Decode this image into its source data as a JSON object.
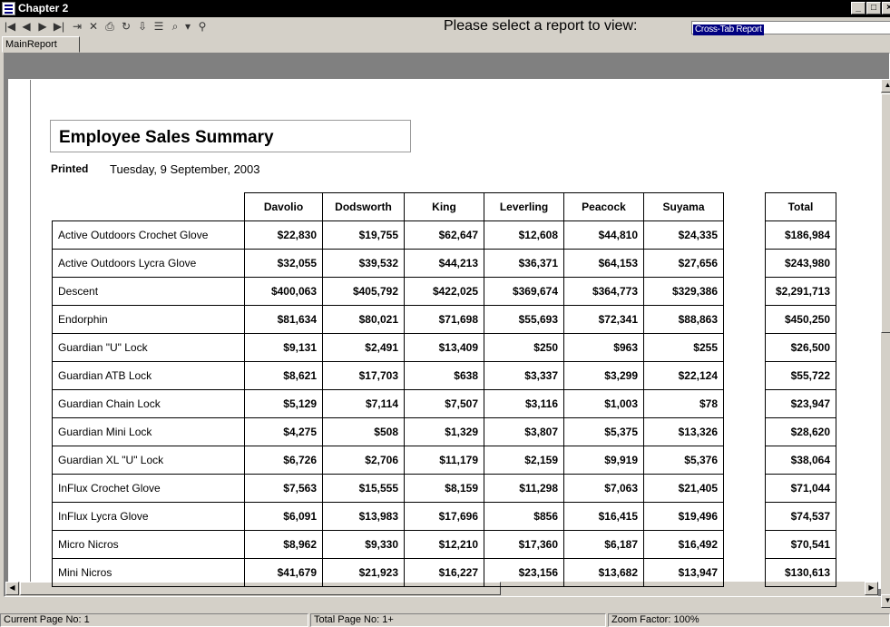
{
  "window": {
    "title": "Chapter 2"
  },
  "toolbar": {
    "icons": [
      "first-page-icon",
      "previous-page-icon",
      "next-page-icon",
      "last-page-icon",
      "goto-page-icon",
      "close-view-icon",
      "print-icon",
      "refresh-icon",
      "export-icon",
      "group-tree-icon",
      "zoom-icon",
      "dropdown-arrow-icon",
      "search-text-icon"
    ],
    "report_prompt": "Please select a report to view:",
    "report_select_value": "Cross-Tab Report"
  },
  "tabs": [
    {
      "label": "MainReport"
    }
  ],
  "report": {
    "title": "Employee Sales Summary",
    "printed_label": "Printed",
    "printed_date": "Tuesday, 9 September, 2003",
    "columns": [
      "Davolio",
      "Dodsworth",
      "King",
      "Leverling",
      "Peacock",
      "Suyama"
    ],
    "total_header": "Total",
    "rows": [
      {
        "product": "Active Outdoors Crochet Glove",
        "values": [
          "$22,830",
          "$19,755",
          "$62,647",
          "$12,608",
          "$44,810",
          "$24,335"
        ],
        "total": "$186,984"
      },
      {
        "product": "Active Outdoors Lycra Glove",
        "values": [
          "$32,055",
          "$39,532",
          "$44,213",
          "$36,371",
          "$64,153",
          "$27,656"
        ],
        "total": "$243,980"
      },
      {
        "product": "Descent",
        "values": [
          "$400,063",
          "$405,792",
          "$422,025",
          "$369,674",
          "$364,773",
          "$329,386"
        ],
        "total": "$2,291,713"
      },
      {
        "product": "Endorphin",
        "values": [
          "$81,634",
          "$80,021",
          "$71,698",
          "$55,693",
          "$72,341",
          "$88,863"
        ],
        "total": "$450,250"
      },
      {
        "product": "Guardian \"U\" Lock",
        "values": [
          "$9,131",
          "$2,491",
          "$13,409",
          "$250",
          "$963",
          "$255"
        ],
        "total": "$26,500"
      },
      {
        "product": "Guardian ATB Lock",
        "values": [
          "$8,621",
          "$17,703",
          "$638",
          "$3,337",
          "$3,299",
          "$22,124"
        ],
        "total": "$55,722"
      },
      {
        "product": "Guardian Chain Lock",
        "values": [
          "$5,129",
          "$7,114",
          "$7,507",
          "$3,116",
          "$1,003",
          "$78"
        ],
        "total": "$23,947"
      },
      {
        "product": "Guardian Mini Lock",
        "values": [
          "$4,275",
          "$508",
          "$1,329",
          "$3,807",
          "$5,375",
          "$13,326"
        ],
        "total": "$28,620"
      },
      {
        "product": "Guardian XL \"U\" Lock",
        "values": [
          "$6,726",
          "$2,706",
          "$11,179",
          "$2,159",
          "$9,919",
          "$5,376"
        ],
        "total": "$38,064"
      },
      {
        "product": "InFlux Crochet Glove",
        "values": [
          "$7,563",
          "$15,555",
          "$8,159",
          "$11,298",
          "$7,063",
          "$21,405"
        ],
        "total": "$71,044"
      },
      {
        "product": "InFlux Lycra Glove",
        "values": [
          "$6,091",
          "$13,983",
          "$17,696",
          "$856",
          "$16,415",
          "$19,496"
        ],
        "total": "$74,537"
      },
      {
        "product": "Micro Nicros",
        "values": [
          "$8,962",
          "$9,330",
          "$12,210",
          "$17,360",
          "$6,187",
          "$16,492"
        ],
        "total": "$70,541"
      },
      {
        "product": "Mini Nicros",
        "values": [
          "$41,679",
          "$21,923",
          "$16,227",
          "$23,156",
          "$13,682",
          "$13,947"
        ],
        "total": "$130,613"
      }
    ]
  },
  "status": {
    "current_page": "Current Page No: 1",
    "total_pages": "Total Page No: 1+",
    "zoom": "Zoom Factor: 100%"
  }
}
